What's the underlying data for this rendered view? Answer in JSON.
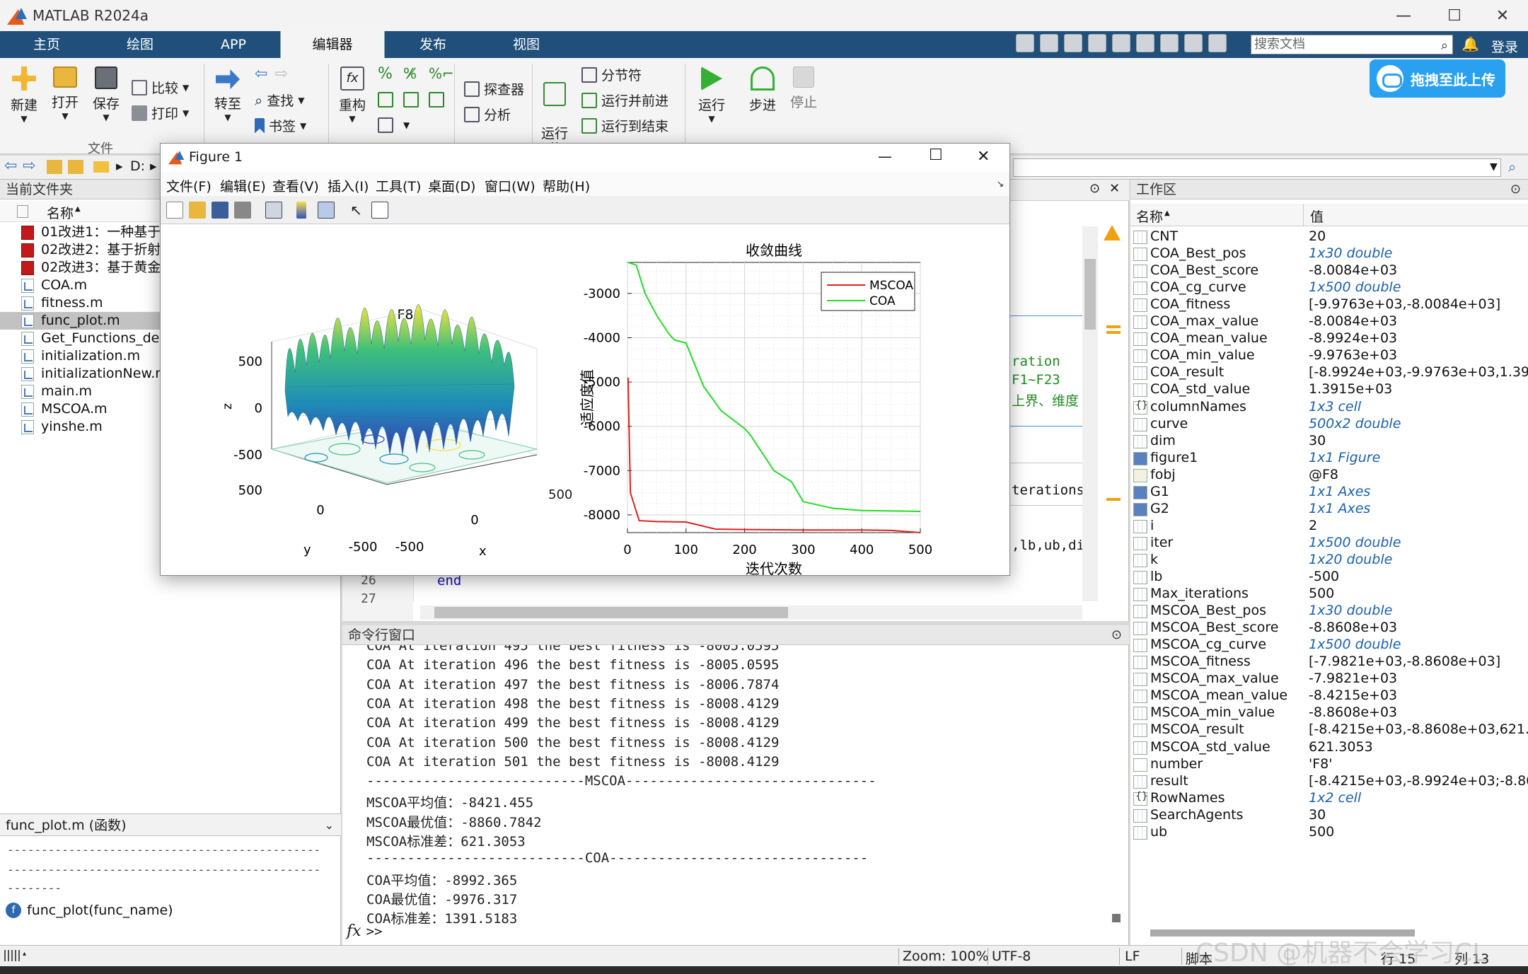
{
  "window": {
    "title": "MATLAB R2024a",
    "min": "—",
    "max": "☐",
    "close": "✕"
  },
  "tabs": [
    "主页",
    "绘图",
    "APP",
    "编辑器",
    "发布",
    "视图"
  ],
  "search_doc_placeholder": "搜索文档",
  "login": "登录",
  "upload_button": "拖拽至此上传",
  "toolstrip": {
    "new": "新建",
    "open": "打开",
    "save": "保存",
    "compare": "比较",
    "print": "打印",
    "goto": "转至",
    "find": "查找",
    "bookmark": "书签",
    "refactor": "重构",
    "profiler": "探查器",
    "analyze": "分析",
    "run_section": "运行\n节",
    "section_break": "分节符",
    "run_advance": "运行并前进",
    "run_to_end": "运行到结束",
    "run": "运行",
    "step": "步进",
    "stop": "停止",
    "group_file": "文件"
  },
  "address": {
    "path": "D:"
  },
  "file_panel": {
    "title": "当前文件夹",
    "col_name": "名称",
    "files": [
      {
        "name": "01改进1：一种基于精",
        "type": "pdf"
      },
      {
        "name": "02改进2：基于折射原",
        "type": "pdf"
      },
      {
        "name": "02改进3：基于黄金正",
        "type": "pdf"
      },
      {
        "name": "COA.m",
        "type": "m"
      },
      {
        "name": "fitness.m",
        "type": "m"
      },
      {
        "name": "func_plot.m",
        "type": "m",
        "selected": true
      },
      {
        "name": "Get_Functions_deta",
        "type": "m"
      },
      {
        "name": "initialization.m",
        "type": "m"
      },
      {
        "name": "initializationNew.m",
        "type": "m"
      },
      {
        "name": "main.m",
        "type": "m"
      },
      {
        "name": "MSCOA.m",
        "type": "m"
      },
      {
        "name": "yinshe.m",
        "type": "m"
      }
    ],
    "detail_title": "func_plot.m  (函数)",
    "detail_line1": "----------------------------------------------",
    "detail_line2": "----------------------------------------------",
    "detail_line3": "--------",
    "signature": "func_plot(func_name)"
  },
  "editor": {
    "line_numbers": [
      "26",
      "27"
    ],
    "snippets": {
      "s1": "ration",
      "s2": "F1~F23",
      "s3": "上界、维度",
      "s4": "terations,",
      "s5": ",lb,ub,di",
      "end_kw": "end"
    }
  },
  "command_window": {
    "title": "命令行窗口",
    "lines": [
      "COA At iteration 495 the best fitness is -8005.0595",
      "COA At iteration 496 the best fitness is -8005.0595",
      "COA At iteration 497 the best fitness is -8006.7874",
      "COA At iteration 498 the best fitness is -8008.4129",
      "COA At iteration 499 the best fitness is -8008.4129",
      "COA At iteration 500 the best fitness is -8008.4129",
      "COA At iteration 501 the best fitness is -8008.4129",
      "---------------------------MSCOA-------------------------------",
      "MSCOA平均值：-8421.455",
      "MSCOA最优值：-8860.7842",
      "MSCOA标准差：621.3053",
      "---------------------------COA--------------------------------",
      "COA平均值：-8992.365",
      "COA最优值：-9976.317",
      "COA标准差：1391.5183"
    ],
    "prompt": ">>",
    "fx": "fx"
  },
  "workspace": {
    "title": "工作区",
    "col_name": "名称",
    "col_value": "值",
    "vars": [
      {
        "name": "CNT",
        "value": "20",
        "kind": "num"
      },
      {
        "name": "COA_Best_pos",
        "value": "1x30 double",
        "kind": "link"
      },
      {
        "name": "COA_Best_score",
        "value": "-8.0084e+03",
        "kind": "num"
      },
      {
        "name": "COA_cg_curve",
        "value": "1x500 double",
        "kind": "link"
      },
      {
        "name": "COA_fitness",
        "value": "[-9.9763e+03,-8.0084e+03]",
        "kind": "num"
      },
      {
        "name": "COA_max_value",
        "value": "-8.0084e+03",
        "kind": "num"
      },
      {
        "name": "COA_mean_value",
        "value": "-8.9924e+03",
        "kind": "num"
      },
      {
        "name": "COA_min_value",
        "value": "-9.9763e+03",
        "kind": "num"
      },
      {
        "name": "COA_result",
        "value": "[-8.9924e+03,-9.9763e+03,1.3915e",
        "kind": "num"
      },
      {
        "name": "COA_std_value",
        "value": "1.3915e+03",
        "kind": "num"
      },
      {
        "name": "columnNames",
        "value": "1x3 cell",
        "kind": "cell"
      },
      {
        "name": "curve",
        "value": "500x2 double",
        "kind": "link"
      },
      {
        "name": "dim",
        "value": "30",
        "kind": "num"
      },
      {
        "name": "figure1",
        "value": "1x1 Figure",
        "kind": "obj"
      },
      {
        "name": "fobj",
        "value": "@F8",
        "kind": "fh"
      },
      {
        "name": "G1",
        "value": "1x1 Axes",
        "kind": "obj"
      },
      {
        "name": "G2",
        "value": "1x1 Axes",
        "kind": "obj"
      },
      {
        "name": "i",
        "value": "2",
        "kind": "num"
      },
      {
        "name": "iter",
        "value": "1x500 double",
        "kind": "link"
      },
      {
        "name": "k",
        "value": "1x20 double",
        "kind": "link"
      },
      {
        "name": "lb",
        "value": "-500",
        "kind": "num"
      },
      {
        "name": "Max_iterations",
        "value": "500",
        "kind": "num"
      },
      {
        "name": "MSCOA_Best_pos",
        "value": "1x30 double",
        "kind": "link"
      },
      {
        "name": "MSCOA_Best_score",
        "value": "-8.8608e+03",
        "kind": "num"
      },
      {
        "name": "MSCOA_cg_curve",
        "value": "1x500 double",
        "kind": "link"
      },
      {
        "name": "MSCOA_fitness",
        "value": "[-7.9821e+03,-8.8608e+03]",
        "kind": "num"
      },
      {
        "name": "MSCOA_max_value",
        "value": "-7.9821e+03",
        "kind": "num"
      },
      {
        "name": "MSCOA_mean_value",
        "value": "-8.4215e+03",
        "kind": "num"
      },
      {
        "name": "MSCOA_min_value",
        "value": "-8.8608e+03",
        "kind": "num"
      },
      {
        "name": "MSCOA_result",
        "value": "[-8.4215e+03,-8.8608e+03,621.305",
        "kind": "num"
      },
      {
        "name": "MSCOA_std_value",
        "value": "621.3053",
        "kind": "num"
      },
      {
        "name": "number",
        "value": "'F8'",
        "kind": "ch"
      },
      {
        "name": "result",
        "value": "[-8.4215e+03,-8.9924e+03;-8.8608e",
        "kind": "num"
      },
      {
        "name": "RowNames",
        "value": "1x2 cell",
        "kind": "cell"
      },
      {
        "name": "SearchAgents",
        "value": "30",
        "kind": "num"
      },
      {
        "name": "ub",
        "value": "500",
        "kind": "num"
      }
    ]
  },
  "statusbar": {
    "zoom": "Zoom: 100%",
    "encoding": "UTF-8",
    "eol": "LF",
    "type": "脚本",
    "row": "行  15",
    "col": "列  13"
  },
  "watermark": "CSDN @机器不会学习CL",
  "figure": {
    "title": "Figure 1",
    "menus": [
      "文件(F)",
      "编辑(E)",
      "查看(V)",
      "插入(I)",
      "工具(T)",
      "桌面(D)",
      "窗口(W)",
      "帮助(H)"
    ],
    "surface": {
      "title": "F8",
      "zlabel": "z",
      "xlabel": "x",
      "ylabel": "y",
      "z_ticks": [
        "500",
        "0",
        "-500"
      ],
      "x_ticks": [
        "-500",
        "0",
        "500"
      ],
      "y_ticks": [
        "500",
        "0",
        "-500"
      ]
    },
    "colors": {
      "mscoa": "#e02020",
      "coa": "#20e020"
    }
  },
  "chart_data": {
    "type": "line",
    "title": "收敛曲线",
    "xlabel": "迭代次数",
    "ylabel": "适应度值",
    "xlim": [
      0,
      500
    ],
    "ylim": [
      -8400,
      -2300
    ],
    "x_ticks": [
      0,
      100,
      200,
      300,
      400,
      500
    ],
    "y_ticks": [
      -3000,
      -4000,
      -5000,
      -6000,
      -7000,
      -8000
    ],
    "grid": true,
    "legend_position": "top-right",
    "series": [
      {
        "name": "MSCOA",
        "x": [
          1,
          5,
          20,
          50,
          100,
          150,
          200,
          300,
          400,
          450,
          500
        ],
        "y": [
          -4900,
          -7500,
          -8130,
          -8150,
          -8160,
          -8320,
          -8330,
          -8340,
          -8340,
          -8350,
          -8400
        ]
      },
      {
        "name": "COA",
        "x": [
          1,
          15,
          30,
          50,
          70,
          80,
          100,
          130,
          160,
          200,
          210,
          250,
          280,
          300,
          350,
          400,
          500
        ],
        "y": [
          -2300,
          -2360,
          -3000,
          -3500,
          -3900,
          -4050,
          -4120,
          -5100,
          -5650,
          -6050,
          -6200,
          -7000,
          -7250,
          -7700,
          -7850,
          -7900,
          -7920
        ]
      }
    ]
  }
}
